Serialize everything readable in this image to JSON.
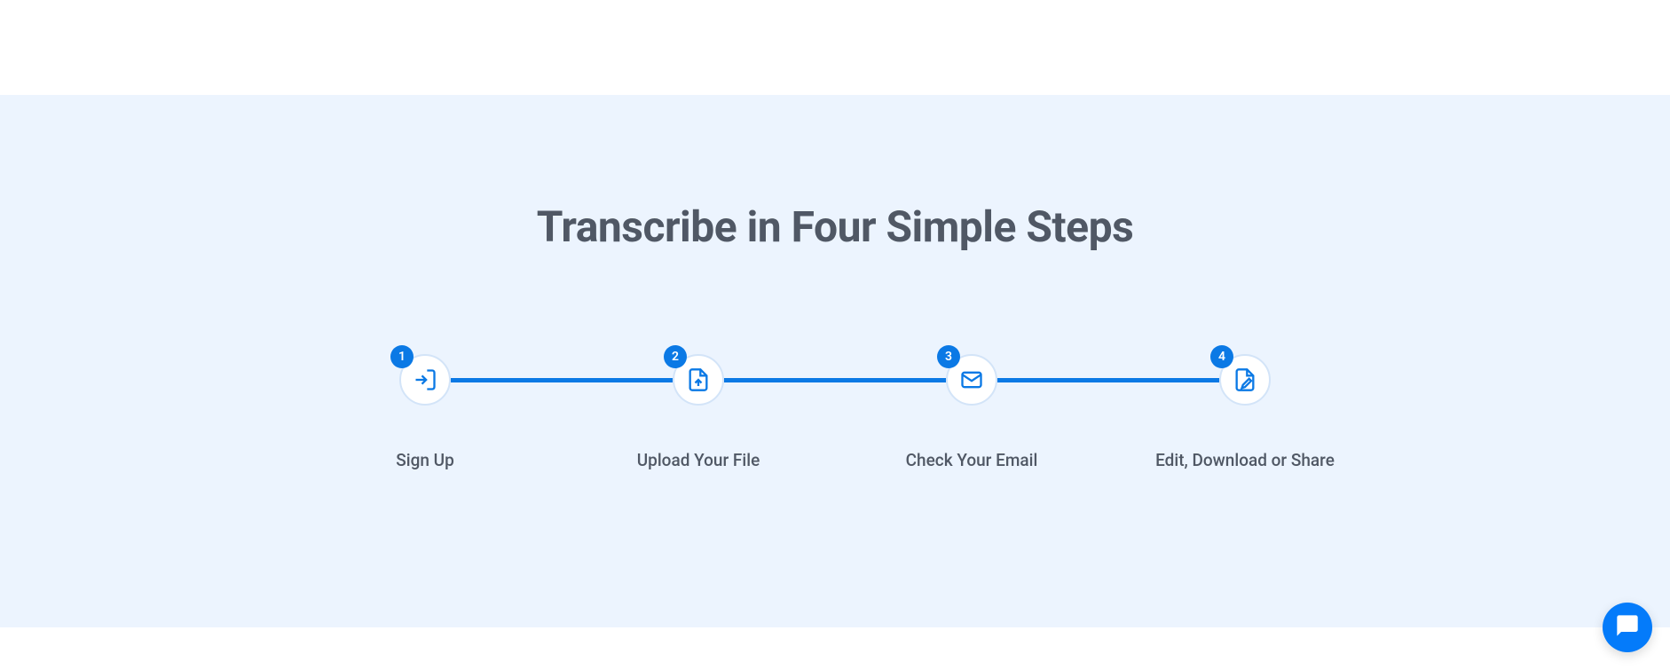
{
  "section": {
    "title": "Transcribe in Four Simple Steps",
    "steps": [
      {
        "number": "1",
        "label": "Sign Up",
        "icon": "sign-in-icon"
      },
      {
        "number": "2",
        "label": "Upload Your File",
        "icon": "file-upload-icon"
      },
      {
        "number": "3",
        "label": "Check Your Email",
        "icon": "email-icon"
      },
      {
        "number": "4",
        "label": "Edit, Download or Share",
        "icon": "file-edit-icon"
      }
    ]
  },
  "colors": {
    "accent": "#0b79e5",
    "background_light": "#ecf4fe",
    "text_heading": "#505865",
    "chat_button": "#047bfa"
  }
}
